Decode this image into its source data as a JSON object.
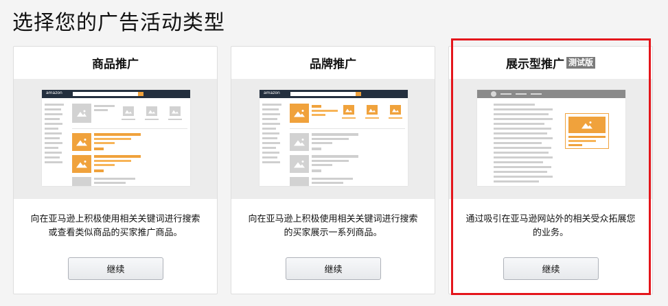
{
  "page": {
    "title": "选择您的广告活动类型"
  },
  "cards": [
    {
      "title": "商品推广",
      "description": "向在亚马逊上积极使用相关关键词进行搜索或查看类似商品的买家推广商品。",
      "button_label": "继续"
    },
    {
      "title": "品牌推广",
      "description": "向在亚马逊上积极使用相关关键词进行搜索的买家展示一系列商品。",
      "button_label": "继续"
    },
    {
      "title": "展示型推广",
      "badge": "测试版",
      "description": "通过吸引在亚马逊网站外的相关受众拓展您的业务。",
      "button_label": "继续"
    }
  ],
  "mock": {
    "logo_text": "amazon"
  },
  "colors": {
    "accent_orange": "#f0a23c",
    "highlight_red": "#e4151b",
    "nav_dark": "#232f3e"
  }
}
